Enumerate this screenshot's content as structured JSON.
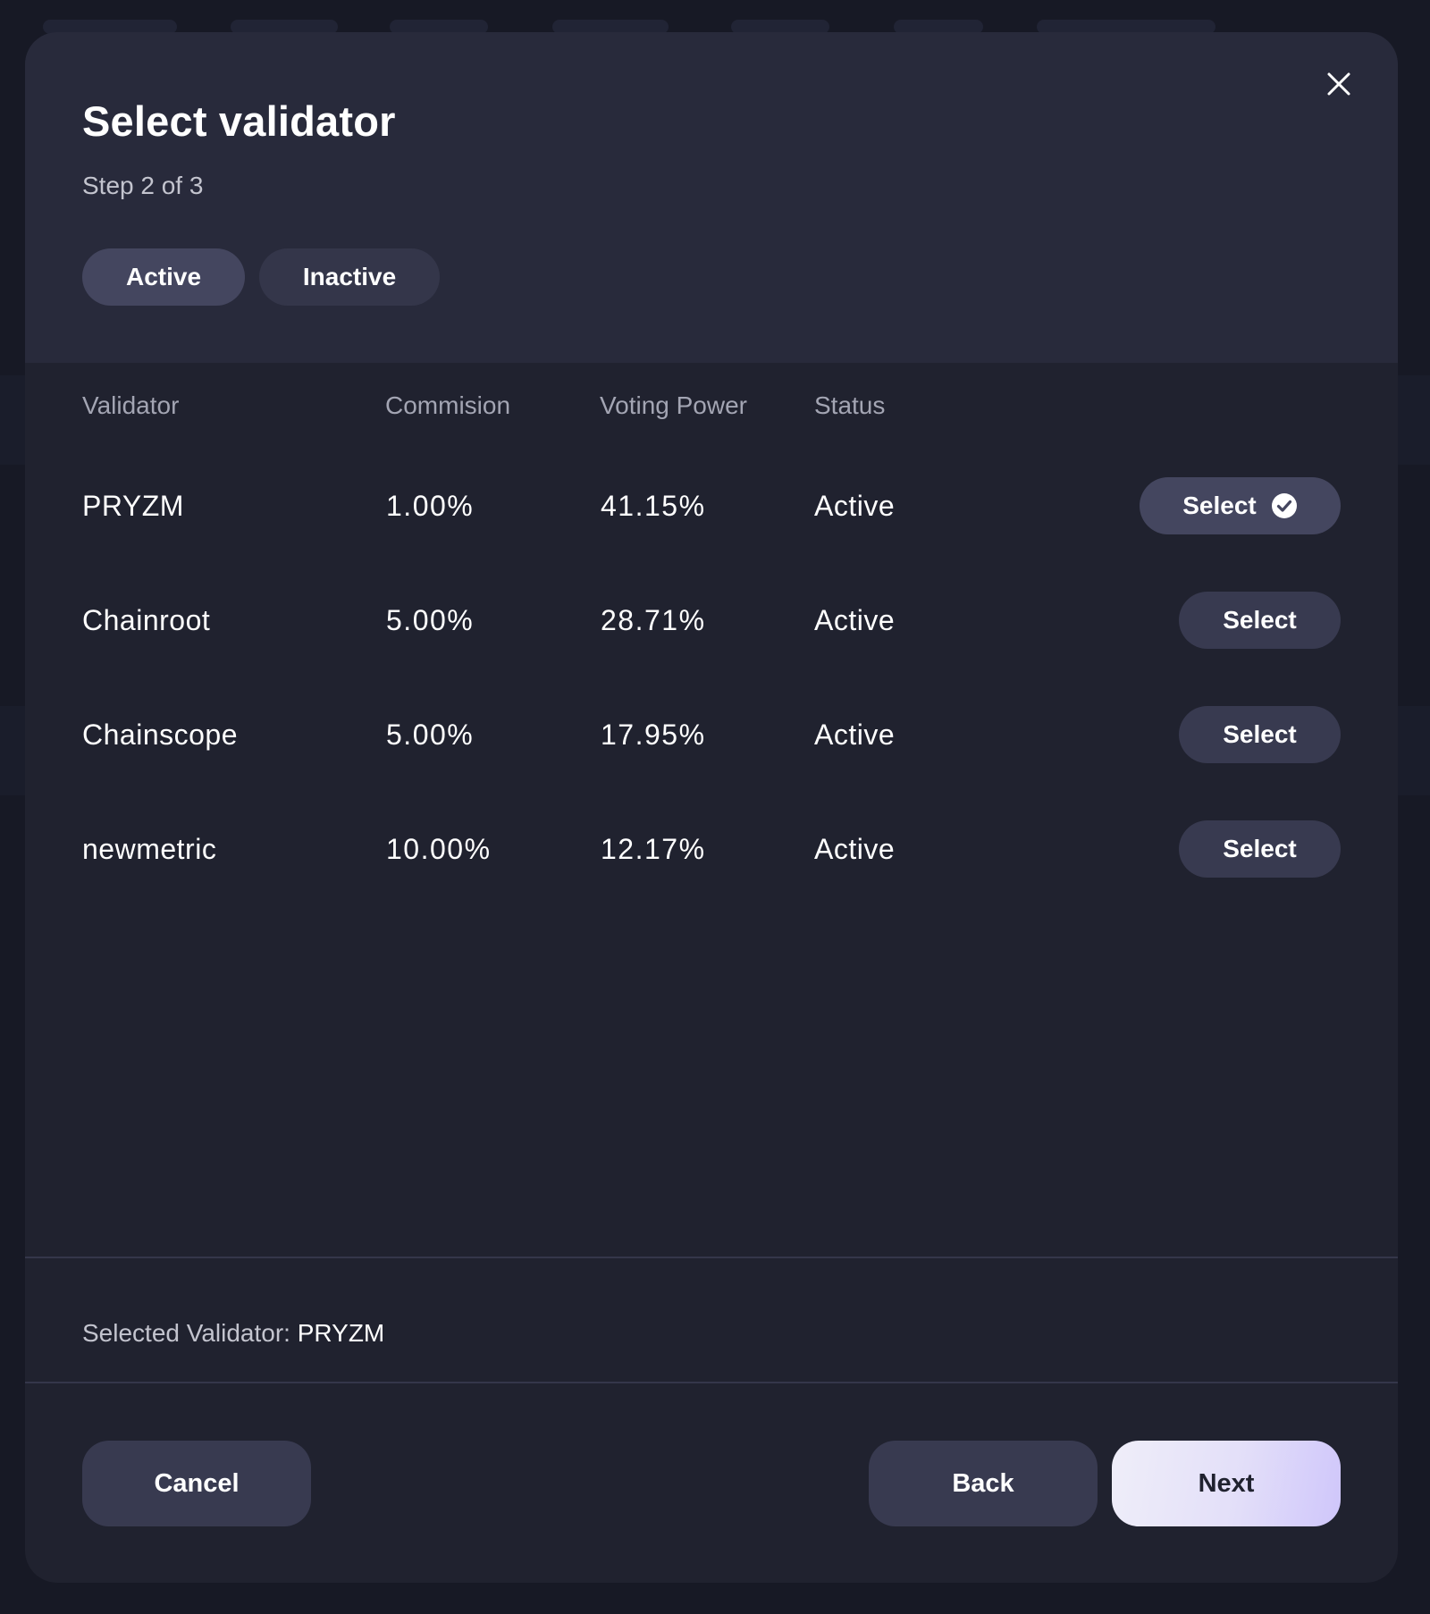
{
  "dialog": {
    "title": "Select validator",
    "step": "Step 2 of 3",
    "filters": [
      {
        "label": "Active",
        "selected": true
      },
      {
        "label": "Inactive",
        "selected": false
      }
    ]
  },
  "table": {
    "columns": [
      "Validator",
      "Commision",
      "Voting Power",
      "Status"
    ],
    "rows": [
      {
        "name": "PRYZM",
        "commission": "1.00%",
        "voting_power": "41.15%",
        "status": "Active",
        "action": "Select",
        "selected": true
      },
      {
        "name": "Chainroot",
        "commission": "5.00%",
        "voting_power": "28.71%",
        "status": "Active",
        "action": "Select",
        "selected": false
      },
      {
        "name": "Chainscope",
        "commission": "5.00%",
        "voting_power": "17.95%",
        "status": "Active",
        "action": "Select",
        "selected": false
      },
      {
        "name": "newmetric",
        "commission": "10.00%",
        "voting_power": "12.17%",
        "status": "Active",
        "action": "Select",
        "selected": false
      }
    ]
  },
  "summary": {
    "label": "Selected Validator:",
    "value": "PRYZM"
  },
  "footer": {
    "cancel_label": "Cancel",
    "back_label": "Back",
    "next_label": "Next"
  },
  "icons": {
    "close": "close-icon",
    "selected": "check-circle-icon"
  },
  "colors": {
    "modal_bg": "#20222f",
    "header_bg": "#282a3b",
    "button_bg": "#383a50",
    "next_gradient_end": "#cfc6fa"
  }
}
